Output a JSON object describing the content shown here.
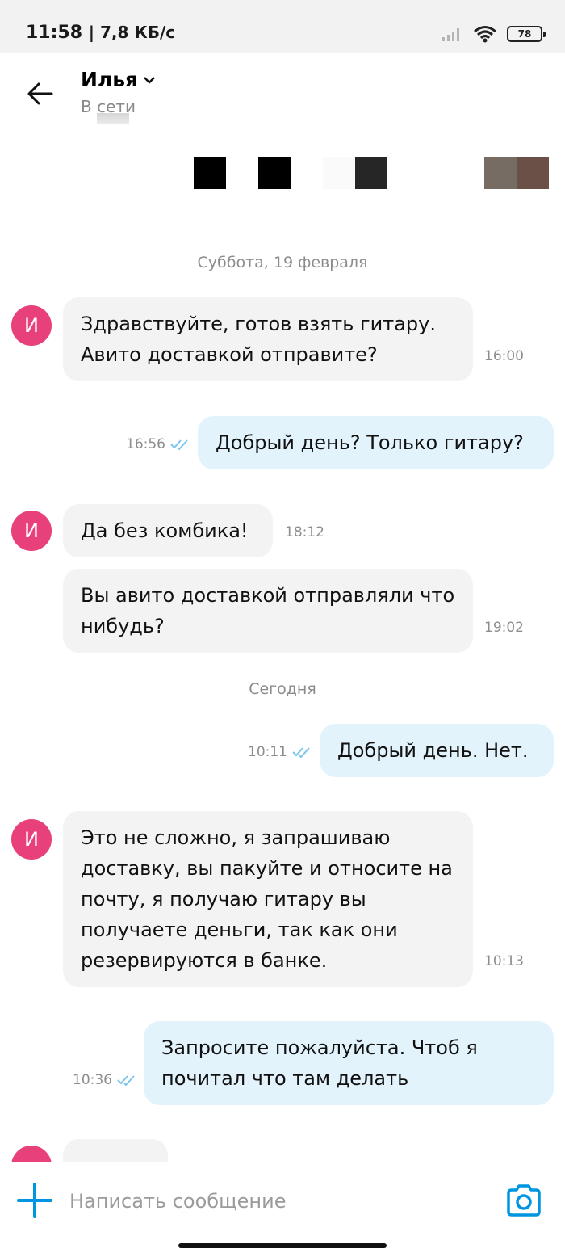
{
  "status_bar": {
    "time": "11:58",
    "network_speed": "| 7,8 КБ/с",
    "battery": "78"
  },
  "header": {
    "contact_name": "Илья",
    "contact_status": "В сети"
  },
  "messages": [
    {
      "type": "date",
      "text": "Суббота, 19 февраля"
    },
    {
      "type": "incoming",
      "avatar": "И",
      "text": "Здравствуйте, готов взять гитару. Авито доставкой отправите?",
      "time": "16:00"
    },
    {
      "type": "outgoing",
      "text": "Добрый день? Только гитару?",
      "time": "16:56",
      "read": true
    },
    {
      "type": "incoming",
      "avatar": "И",
      "text": "Да без комбика!",
      "time": "18:12"
    },
    {
      "type": "incoming",
      "text": "Вы авито доставкой отправляли что нибудь?",
      "time": "19:02"
    },
    {
      "type": "date",
      "text": "Сегодня"
    },
    {
      "type": "outgoing",
      "text": "Добрый день. Нет.",
      "time": "10:11",
      "read": true
    },
    {
      "type": "incoming",
      "avatar": "И",
      "text": "Это не сложно, я запрашиваю доставку, вы пакуйте и относите на почту, я получаю гитару вы получаете деньги, так как они резервируются в банке.",
      "time": "10:13"
    },
    {
      "type": "outgoing",
      "text": "Запросите пожалуйста. Чтоб я почитал что там делать",
      "time": "10:36",
      "read": true
    }
  ],
  "composer": {
    "placeholder": "Написать сообщение"
  },
  "colors": {
    "accent": "#0095e0",
    "avatar": "#e8407a",
    "incoming_bubble": "#f3f3f3",
    "outgoing_bubble": "#e3f3fc",
    "read_check": "#7cc7ec"
  }
}
